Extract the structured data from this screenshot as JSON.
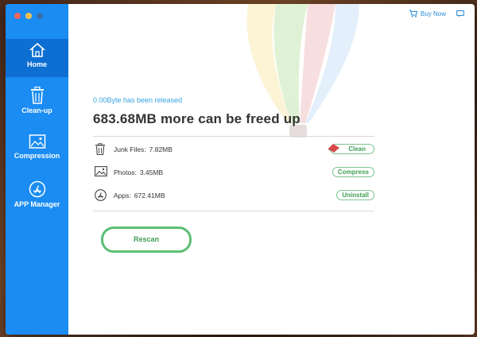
{
  "sidebar": {
    "items": [
      {
        "label": "Home",
        "icon": "home-icon",
        "active": true
      },
      {
        "label": "Clean-up",
        "icon": "trash-icon",
        "active": false
      },
      {
        "label": "Compression",
        "icon": "image-icon",
        "active": false
      },
      {
        "label": "APP Manager",
        "icon": "app-store-icon",
        "active": false
      }
    ]
  },
  "header": {
    "buy_now": "Buy Now",
    "cart_icon": "cart-icon",
    "chat_icon": "chat-icon"
  },
  "summary": {
    "released": "0.00Byte has been released",
    "freed": "683.68MB more can be freed up"
  },
  "rows": [
    {
      "label": "Junk Files:",
      "value": "7.82MB",
      "action": "Clean",
      "icon": "trash-icon"
    },
    {
      "label": "Photos:",
      "value": "3.45MB",
      "action": "Compress",
      "icon": "image-icon"
    },
    {
      "label": "Apps:",
      "value": "672.41MB",
      "action": "Uninstall",
      "icon": "app-store-icon"
    }
  ],
  "rescan_label": "Rescan",
  "colors": {
    "sidebar": "#1a8cf2",
    "sidebar_active": "#0d6fd1",
    "accent_green": "#5cbf73",
    "link_blue": "#37a3e5"
  }
}
